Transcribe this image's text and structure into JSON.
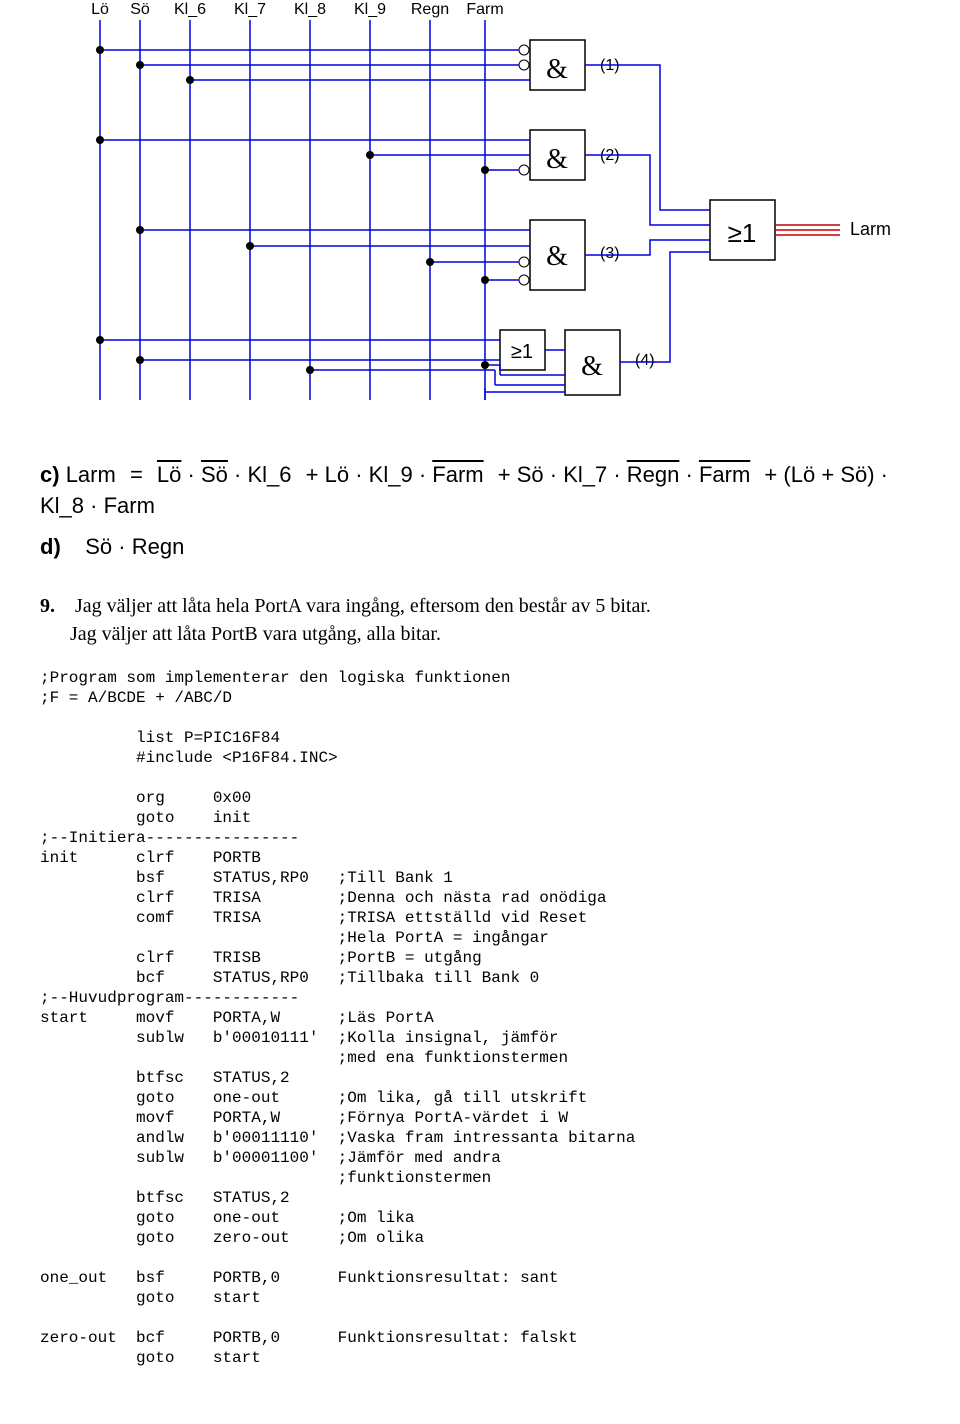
{
  "diagram": {
    "inputs": [
      "Lö",
      "Sö",
      "Kl_6",
      "Kl_7",
      "Kl_8",
      "Kl_9",
      "Regn",
      "Farm"
    ],
    "gates": {
      "g1": "&",
      "g2": "&",
      "g3": "&",
      "g4": "&",
      "or5": "≥1",
      "or_out": "≥1"
    },
    "gate_out_labels": {
      "g1": "(1)",
      "g2": "(2)",
      "g3": "(3)",
      "g4": "(4)"
    },
    "output_label": "Larm"
  },
  "equation": {
    "c_prefix": "c) ",
    "larm": "Larm",
    "eq": "=",
    "terms": {
      "lo_bar": "Lö",
      "so_bar": "Sö",
      "kl6": "Kl_6",
      "plus": "+",
      "lo": "Lö",
      "kl9": "Kl_9",
      "farm_bar": "Farm",
      "so": "Sö",
      "kl7": "Kl_7",
      "regn_bar": "Regn",
      "farm_bar2": "Farm",
      "open": "(",
      "close": ")",
      "kl8": "Kl_8",
      "farm": "Farm"
    },
    "d_prefix": "d) ",
    "d_expr": {
      "so": "Sö",
      "regn": "Regn"
    }
  },
  "section9": {
    "num": "9.",
    "line1": "Jag väljer att låta hela PortA vara ingång, eftersom den består av 5 bitar.",
    "line2": "Jag väljer att låta PortB vara utgång, alla bitar."
  },
  "code_lines": [
    ";Program som implementerar den logiska funktionen",
    ";F = A/BCDE + /ABC/D",
    "",
    "          list P=PIC16F84",
    "          #include <P16F84.INC>",
    "",
    "          org     0x00",
    "          goto    init",
    ";--Initiera----------------",
    "init      clrf    PORTB",
    "          bsf     STATUS,RP0   ;Till Bank 1",
    "          clrf    TRISA        ;Denna och nästa rad onödiga",
    "          comf    TRISA        ;TRISA ettställd vid Reset",
    "                               ;Hela PortA = ingångar",
    "          clrf    TRISB        ;PortB = utgång",
    "          bcf     STATUS,RP0   ;Tillbaka till Bank 0",
    ";--Huvudprogram------------",
    "start     movf    PORTA,W      ;Läs PortA",
    "          sublw   b'00010111'  ;Kolla insignal, jämför",
    "                               ;med ena funktionstermen",
    "          btfsc   STATUS,2",
    "          goto    one-out      ;Om lika, gå till utskrift",
    "          movf    PORTA,W      ;Förnya PortA-värdet i W",
    "          andlw   b'00011110'  ;Vaska fram intressanta bitarna",
    "          sublw   b'00001100'  ;Jämför med andra",
    "                               ;funktionstermen",
    "          btfsc   STATUS,2",
    "          goto    one-out      ;Om lika",
    "          goto    zero-out     ;Om olika",
    "",
    "one_out   bsf     PORTB,0      Funktionsresultat: sant",
    "          goto    start",
    "",
    "zero-out  bcf     PORTB,0      Funktionsresultat: falskt",
    "          goto    start"
  ]
}
